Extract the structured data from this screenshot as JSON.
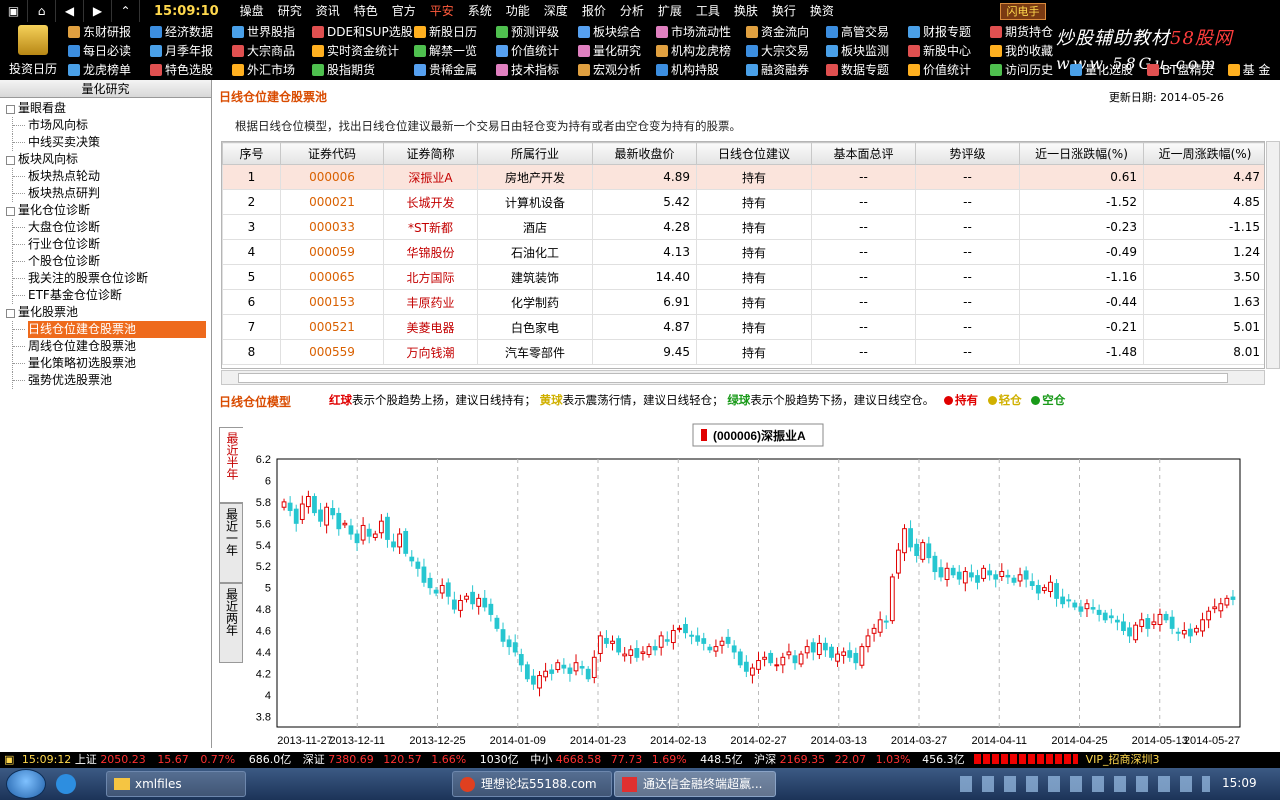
{
  "topbar": {
    "clock": "15:09:10",
    "menu": [
      "操盘",
      "研究",
      "资讯",
      "特色",
      "官方",
      "平安",
      "系统",
      "功能",
      "深度",
      "报价",
      "分析",
      "扩展",
      "工具",
      "换肤",
      "换行",
      "换资"
    ],
    "active_index": 5,
    "flash": "闪电手"
  },
  "toolbar": {
    "big_label": "投资日历",
    "columns": [
      [
        "东财研报",
        "每日必读",
        "龙虎榜单"
      ],
      [
        "经济数据",
        "月季年报",
        "特色选股"
      ],
      [
        "世界股指",
        "大宗商品",
        "外汇市场"
      ],
      [
        "DDE和SUP选股",
        "实时资金统计",
        "股指期货"
      ],
      [
        "新股日历",
        "解禁一览",
        "贵稀金属"
      ],
      [
        "预测评级",
        "价值统计",
        "技术指标"
      ],
      [
        "板块综合",
        "量化研究",
        "宏观分析"
      ],
      [
        "市场流动性",
        "机构龙虎榜",
        "机构持股"
      ],
      [
        "资金流向",
        "大宗交易",
        "融资融券"
      ],
      [
        "高管交易",
        "板块监测",
        "数据专题"
      ],
      [
        "财报专题",
        "新股中心",
        "价值统计"
      ],
      [
        "期货持仓",
        "我的收藏",
        "访问历史"
      ]
    ],
    "extra": [
      "量化选股",
      "BT盘精灵",
      "基 金"
    ],
    "icon_colors": [
      "#e0a040",
      "#3c8ee0",
      "#4aa0e8",
      "#e05050",
      "#ffb020",
      "#4fc04f",
      "#56a0f0",
      "#e080c0"
    ]
  },
  "watermark": {
    "line1a": "炒股辅助教材",
    "line1b": "58股网",
    "line2": "www.58Gu.com"
  },
  "sidebar": {
    "title": "量化研究",
    "nodes": [
      {
        "t": "量眼看盘",
        "lvl": 0
      },
      {
        "t": "市场风向标",
        "lvl": 1
      },
      {
        "t": "中线买卖决策",
        "lvl": 1
      },
      {
        "t": "板块风向标",
        "lvl": 0
      },
      {
        "t": "板块热点轮动",
        "lvl": 1
      },
      {
        "t": "板块热点研判",
        "lvl": 1
      },
      {
        "t": "量化仓位诊断",
        "lvl": 0
      },
      {
        "t": "大盘仓位诊断",
        "lvl": 1
      },
      {
        "t": "行业仓位诊断",
        "lvl": 1
      },
      {
        "t": "个股仓位诊断",
        "lvl": 1
      },
      {
        "t": "我关注的股票仓位诊断",
        "lvl": 1
      },
      {
        "t": "ETF基金仓位诊断",
        "lvl": 1
      },
      {
        "t": "量化股票池",
        "lvl": 0
      },
      {
        "t": "日线仓位建仓股票池",
        "lvl": 1,
        "sel": true
      },
      {
        "t": "周线仓位建仓股票池",
        "lvl": 1
      },
      {
        "t": "量化策略初选股票池",
        "lvl": 1
      },
      {
        "t": "强势优选股票池",
        "lvl": 1
      }
    ]
  },
  "main": {
    "title": "日线仓位建仓股票池",
    "update_label": "更新日期:",
    "update_date": "2014-05-26",
    "desc": "根据日线仓位模型，找出日线仓位建议最新一个交易日由轻仓变为持有或者由空仓变为持有的股票。",
    "columns": [
      "序号",
      "证券代码",
      "证券简称",
      "所属行业",
      "最新收盘价",
      "日线仓位建议",
      "基本面总评",
      "势评级",
      "近一日涨跌幅(%)",
      "近一周涨跌幅(%)"
    ],
    "rows": [
      [
        "1",
        "000006",
        "深振业A",
        "房地产开发",
        "4.89",
        "持有",
        "--",
        "--",
        "0.61",
        "4.47"
      ],
      [
        "2",
        "000021",
        "长城开发",
        "计算机设备",
        "5.42",
        "持有",
        "--",
        "--",
        "-1.52",
        "4.85"
      ],
      [
        "3",
        "000033",
        "*ST新都",
        "酒店",
        "4.28",
        "持有",
        "--",
        "--",
        "-0.23",
        "-1.15"
      ],
      [
        "4",
        "000059",
        "华锦股份",
        "石油化工",
        "4.13",
        "持有",
        "--",
        "--",
        "-0.49",
        "1.24"
      ],
      [
        "5",
        "000065",
        "北方国际",
        "建筑装饰",
        "14.40",
        "持有",
        "--",
        "--",
        "-1.16",
        "3.50"
      ],
      [
        "6",
        "000153",
        "丰原药业",
        "化学制药",
        "6.91",
        "持有",
        "--",
        "--",
        "-0.44",
        "1.63"
      ],
      [
        "7",
        "000521",
        "美菱电器",
        "白色家电",
        "4.87",
        "持有",
        "--",
        "--",
        "-0.21",
        "5.01"
      ],
      [
        "8",
        "000559",
        "万向钱潮",
        "汽车零部件",
        "9.45",
        "持有",
        "--",
        "--",
        "-1.48",
        "8.01"
      ]
    ],
    "model_title": "日线仓位模型",
    "legend": {
      "red": "红球",
      "red_t": "表示个股趋势上扬，建议日线持有；",
      "yellow": "黄球",
      "yellow_t": "表示震荡行情，建议日线轻仓；",
      "green": "绿球",
      "green_t": "表示个股趋势下扬，建议日线空仓。",
      "k1": "持有",
      "k2": "轻仓",
      "k3": "空仓"
    },
    "tabs": [
      "最近半年",
      "最近一年",
      "最近两年"
    ]
  },
  "colors": {
    "up": "#e00000",
    "down": "#26c6d0",
    "dot_red": "#e00000",
    "dot_yellow": "#d0b000",
    "dot_green": "#1a9a1a",
    "orange": "#d94b00"
  },
  "status": {
    "time": "15:09:12",
    "sh_label": "上证",
    "sh_val": "2050.23",
    "sh_chg": "15.67",
    "sh_pct": "0.77%",
    "sh_amt": "686.0亿",
    "sz_label": "深证",
    "sz_val": "7380.69",
    "sz_chg": "120.57",
    "sz_pct": "1.66%",
    "sz_amt": "1030亿",
    "zx_label": "中小",
    "zx_val": "4668.58",
    "zx_chg": "77.73",
    "zx_pct": "1.69%",
    "zx_amt": "448.5亿",
    "hs_label": "沪深",
    "hs_val": "2169.35",
    "hs_chg": "22.07",
    "hs_pct": "1.03%",
    "hs_amt": "456.3亿",
    "vip": "VIP_招商深圳3"
  },
  "taskbar": {
    "items": [
      "xmlfiles",
      "理想论坛55188.com",
      "通达信金融终端超赢..."
    ],
    "clock": "15:09"
  },
  "chart_data": {
    "type": "candlestick",
    "title": "(000006)深振业A",
    "ylim": [
      3.7,
      6.2
    ],
    "yticks": [
      3.8,
      4.0,
      4.2,
      4.4,
      4.6,
      4.8,
      5.0,
      5.2,
      5.4,
      5.6,
      5.8,
      6.0,
      6.2
    ],
    "xticks": [
      "2013-11-27",
      "2013-12-11",
      "2013-12-25",
      "2014-01-09",
      "2014-01-23",
      "2014-02-13",
      "2014-02-27",
      "2014-03-13",
      "2014-03-27",
      "2014-04-11",
      "2014-04-25",
      "2014-05-13",
      "2014-05-27"
    ],
    "closes": [
      5.8,
      5.72,
      5.6,
      5.78,
      5.85,
      5.7,
      5.62,
      5.75,
      5.68,
      5.55,
      5.6,
      5.5,
      5.42,
      5.58,
      5.48,
      5.5,
      5.62,
      5.45,
      5.38,
      5.5,
      5.32,
      5.25,
      5.18,
      5.05,
      5.0,
      4.95,
      5.02,
      4.92,
      4.8,
      4.88,
      4.92,
      4.85,
      4.9,
      4.82,
      4.75,
      4.62,
      4.5,
      4.45,
      4.4,
      4.28,
      4.15,
      4.1,
      4.18,
      4.22,
      4.2,
      4.3,
      4.25,
      4.2,
      4.3,
      4.25,
      4.15,
      4.35,
      4.55,
      4.48,
      4.5,
      4.4,
      4.38,
      4.42,
      4.35,
      4.4,
      4.45,
      4.42,
      4.55,
      4.5,
      4.6,
      4.62,
      4.58,
      4.55,
      4.5,
      4.48,
      4.42,
      4.45,
      4.5,
      4.48,
      4.4,
      4.28,
      4.22,
      4.25,
      4.32,
      4.35,
      4.3,
      4.28,
      4.35,
      4.4,
      4.3,
      4.38,
      4.45,
      4.4,
      4.48,
      4.42,
      4.35,
      4.38,
      4.4,
      4.35,
      4.3,
      4.45,
      4.55,
      4.62,
      4.7,
      4.68,
      5.1,
      5.35,
      5.55,
      5.38,
      5.3,
      5.42,
      5.28,
      5.15,
      5.1,
      5.18,
      5.12,
      5.08,
      5.15,
      5.1,
      5.05,
      5.18,
      5.12,
      5.08,
      5.15,
      5.1,
      5.05,
      5.12,
      5.08,
      5.02,
      4.95,
      5.0,
      5.05,
      4.9,
      4.85,
      4.88,
      4.82,
      4.78,
      4.85,
      4.8,
      4.75,
      4.7,
      4.72,
      4.68,
      4.6,
      4.55,
      4.65,
      4.7,
      4.62,
      4.68,
      4.75,
      4.7,
      4.62,
      4.58,
      4.6,
      4.55,
      4.62,
      4.7,
      4.78,
      4.82,
      4.85,
      4.9,
      4.89
    ]
  }
}
